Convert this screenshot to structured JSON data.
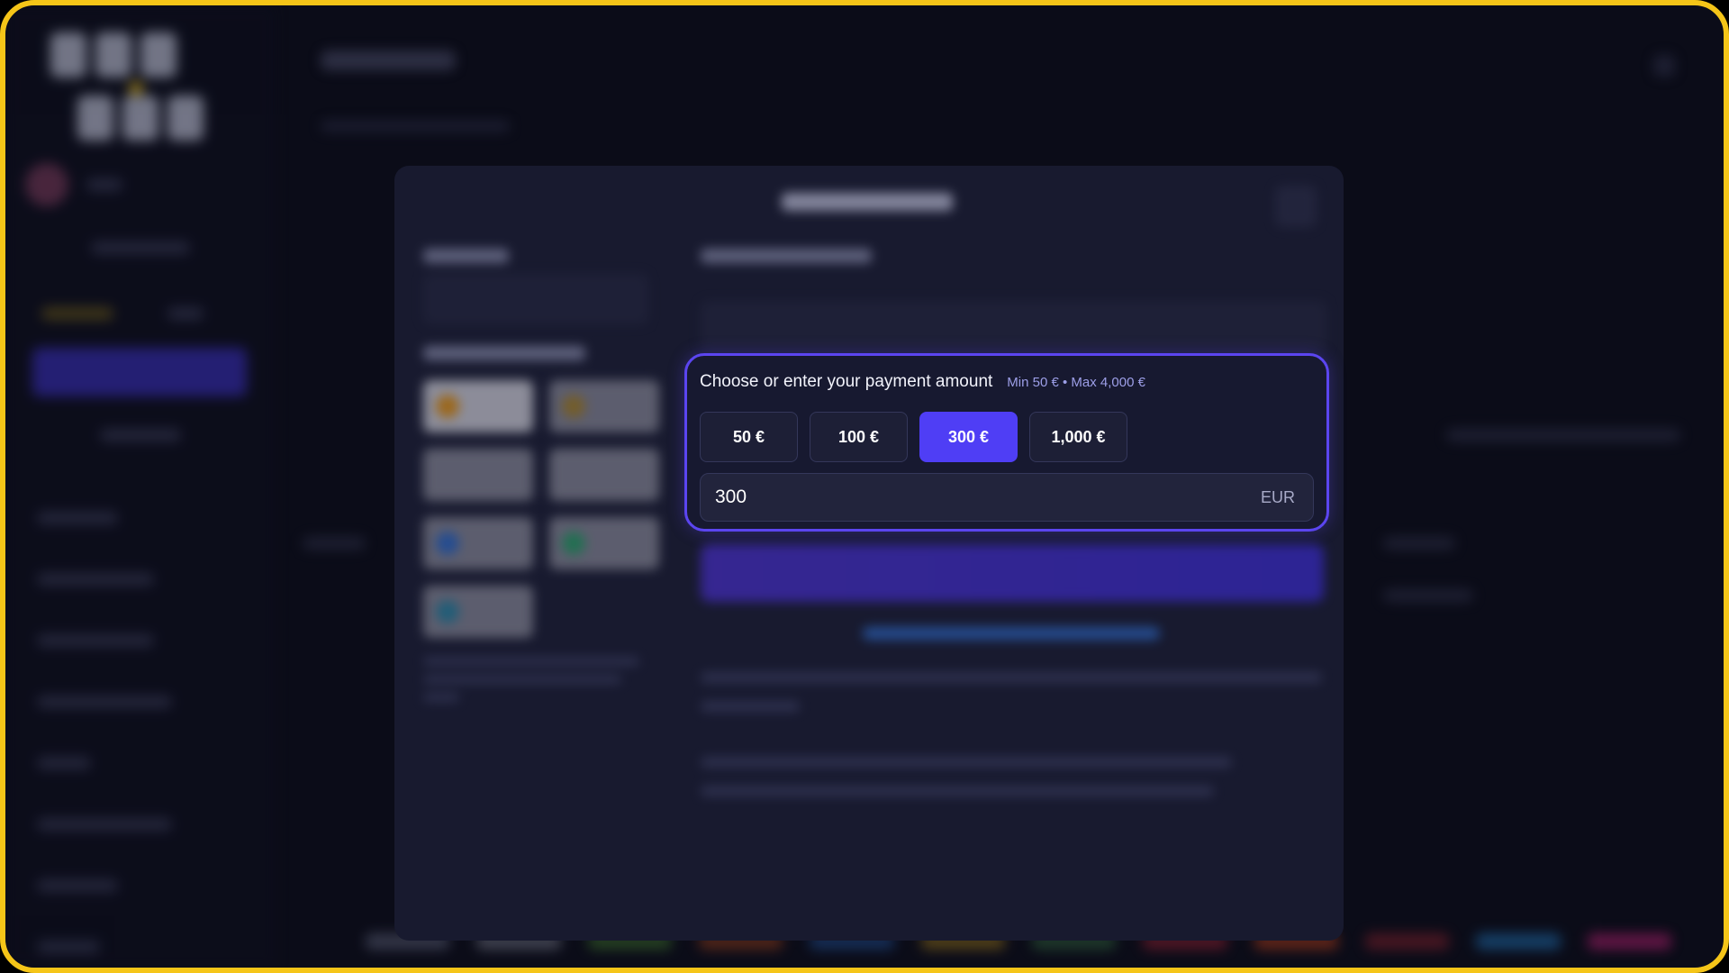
{
  "amount_panel": {
    "title": "Choose or enter your payment amount",
    "limits": "Min 50 € • Max 4,000 €",
    "presets": [
      {
        "label": "50 €",
        "selected": false
      },
      {
        "label": "100 €",
        "selected": false
      },
      {
        "label": "300 €",
        "selected": true
      },
      {
        "label": "1,000 €",
        "selected": false
      }
    ],
    "input_value": "300",
    "currency_suffix": "EUR"
  },
  "colors": {
    "frame_border": "#f5c518",
    "accent": "#4f3ef5",
    "panel_border": "#5b45f0",
    "background": "#0b0c18"
  },
  "icons": {
    "modal_close": "close-icon",
    "payment_method_coin": "coin-icon"
  }
}
